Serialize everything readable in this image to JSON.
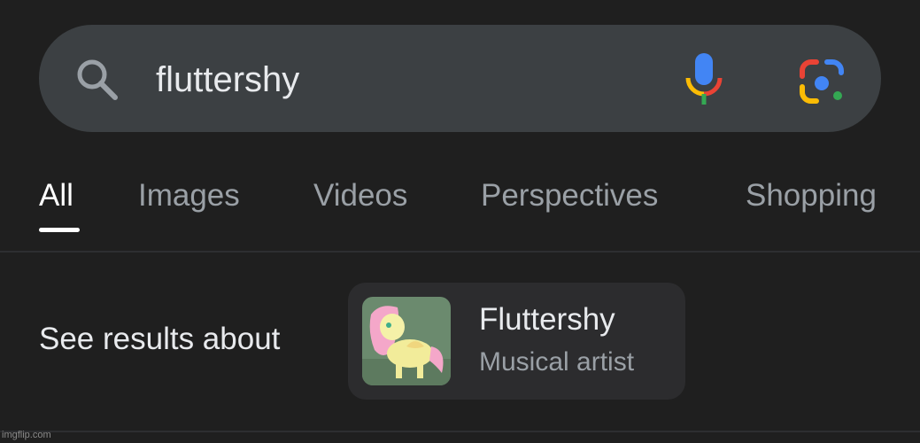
{
  "search": {
    "query": "fluttershy",
    "search_icon": "search-icon",
    "mic_icon": "microphone-icon",
    "lens_icon": "google-lens-icon"
  },
  "tabs": [
    {
      "label": "All",
      "active": true
    },
    {
      "label": "Images",
      "active": false
    },
    {
      "label": "Videos",
      "active": false
    },
    {
      "label": "Perspectives",
      "active": false
    },
    {
      "label": "Shopping",
      "active": false
    }
  ],
  "knowledge": {
    "prompt": "See results about",
    "entity": {
      "title": "Fluttershy",
      "subtitle": "Musical artist",
      "thumbnail_icon": "pony-thumbnail"
    }
  },
  "colors": {
    "background": "#1f1f1f",
    "searchbar": "#3c4043",
    "google_blue": "#4285f4",
    "google_red": "#ea4335",
    "google_yellow": "#fbbc05",
    "google_green": "#34a853"
  },
  "watermark": "imgflip.com"
}
